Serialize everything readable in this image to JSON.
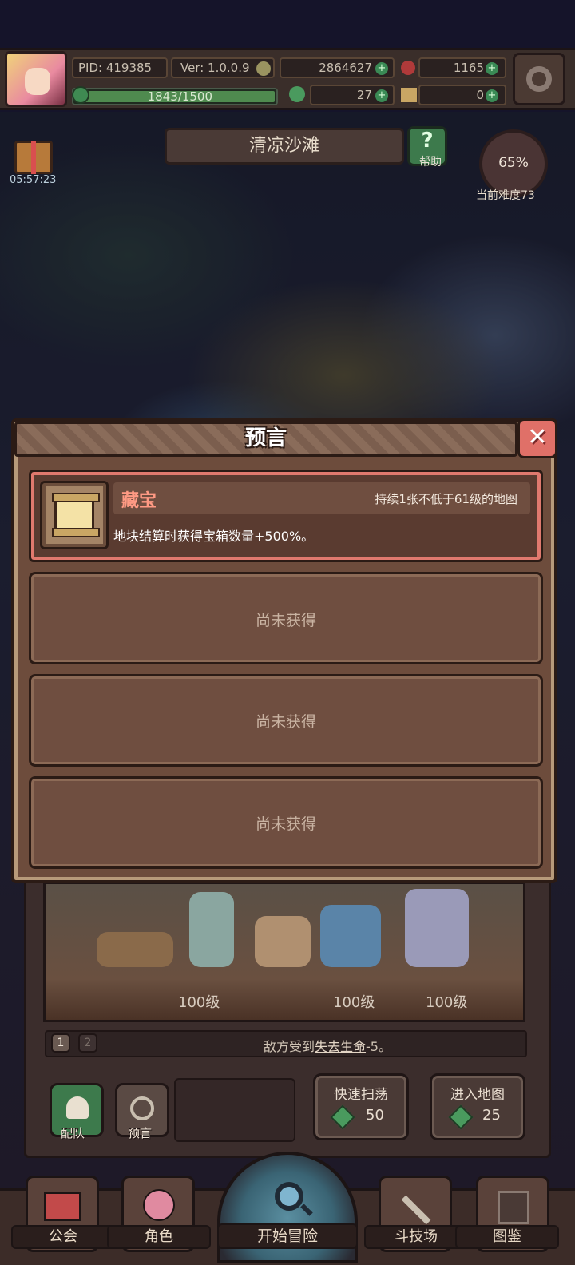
{
  "header": {
    "pid": "PID: 419385",
    "version": "Ver: 1.0.0.9",
    "gold": "2864627",
    "gems": "1165",
    "clover": "27",
    "keys": "0",
    "xp": "1843/1500",
    "xp_ratio": 1.0
  },
  "map": {
    "location": "清凉沙滩",
    "help_label": "帮助",
    "gift_timer": "05:57:23",
    "difficulty_pct": "65%",
    "difficulty_label": "当前难度73"
  },
  "modal": {
    "title": "预言",
    "close_glyph": "✕",
    "active_slot": {
      "name": "藏宝",
      "condition": "持续1张不低于61级的地图",
      "effect": "地块结算时获得宝箱数量+500%。"
    },
    "empty_slots": [
      "尚未获得",
      "尚未获得",
      "尚未获得"
    ]
  },
  "battle": {
    "levels": [
      "100级",
      "100级",
      "100级"
    ],
    "pages": [
      "1",
      "2"
    ],
    "message_prefix": "敌方受到",
    "message_highlight": "失去生命",
    "message_suffix": "-5。"
  },
  "actions": {
    "team": "配队",
    "prophecy": "预言",
    "sweep_title": "快速扫荡",
    "sweep_cost": "50",
    "enter_title": "进入地图",
    "enter_cost": "25"
  },
  "nav": {
    "guild": "公会",
    "character": "角色",
    "adventure": "开始冒险",
    "arena": "斗技场",
    "codex": "图鉴"
  },
  "colors": {
    "accent_red": "#e07068",
    "panel_brown": "#6d4c3c",
    "clover_green": "#4a9a5e"
  }
}
